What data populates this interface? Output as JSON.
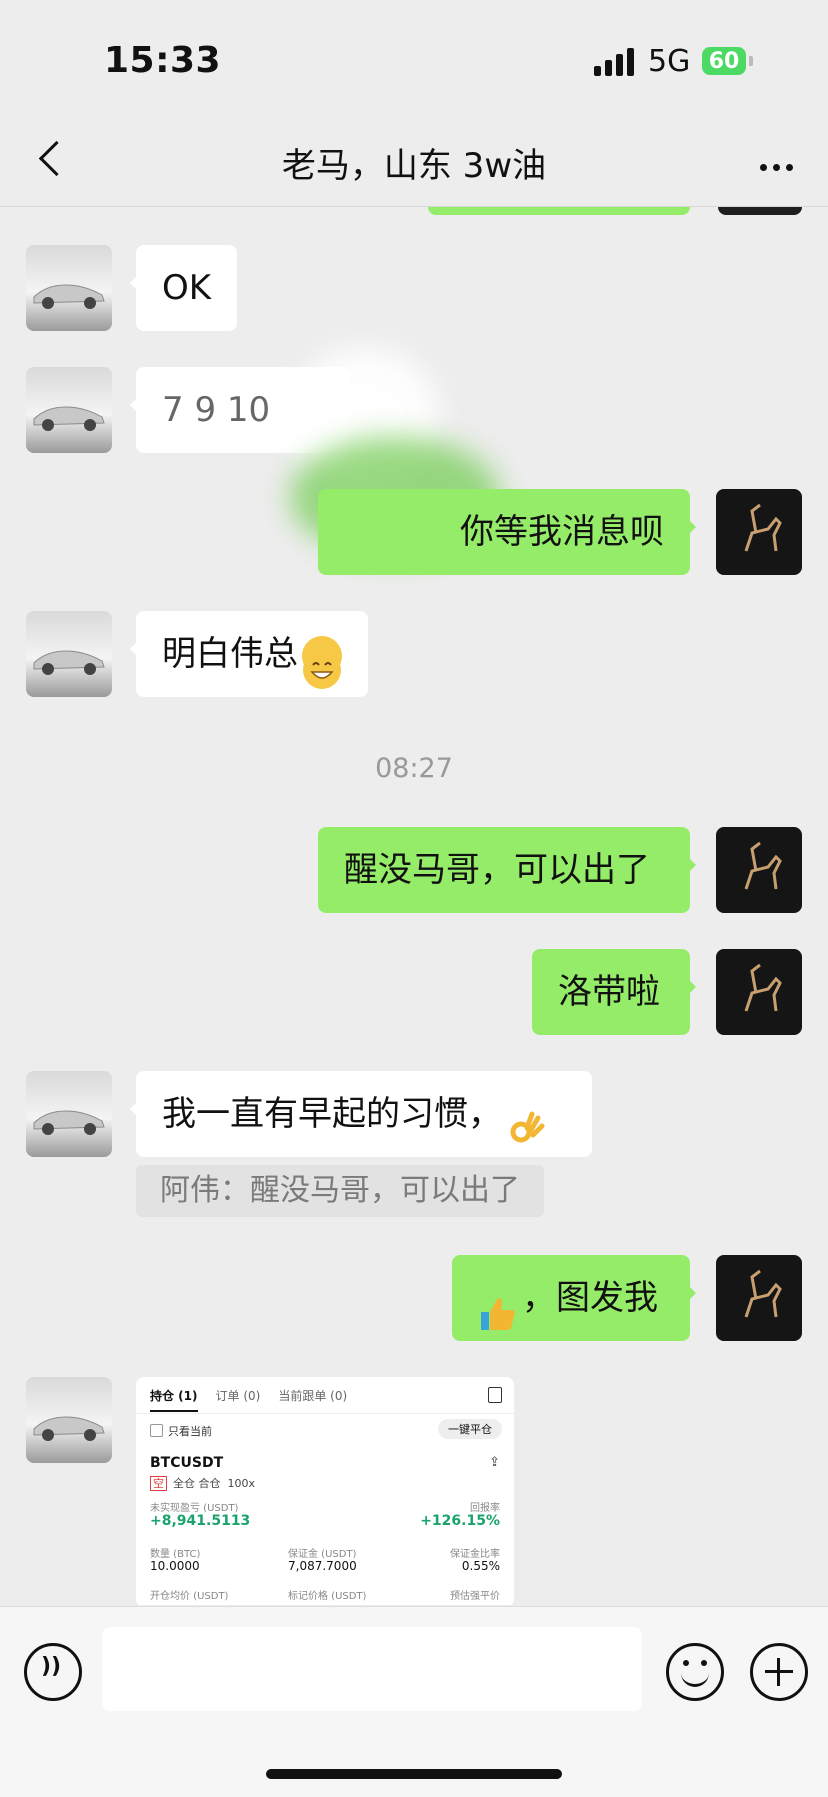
{
  "status_bar": {
    "time": "15:33",
    "network": "5G",
    "battery": "60"
  },
  "nav": {
    "title": "老马，山东 3w油"
  },
  "messages": {
    "m1": "OK",
    "m2": "7   9 10",
    "m3": "你等我消息呗",
    "m4": "明白伟总",
    "time_divider": "08:27",
    "m5": "醒没马哥，可以出了",
    "m6": "洛带啦",
    "m7": "我一直有早起的习惯，",
    "m7_quote": "阿伟：醒没马哥，可以出了",
    "m8": "，图发我"
  },
  "emojis": {
    "m4": "grinning-face-emoji",
    "m7": "ok-hand-emoji",
    "m8": "thumbs-up-emoji"
  },
  "card": {
    "tab_positions": "持仓 (1)",
    "tab_orders": "订单 (0)",
    "tab_copy": "当前跟单 (0)",
    "checkbox_label": "只看当前",
    "close_all": "一键平仓",
    "symbol": "BTCUSDT",
    "tag_short": "空",
    "tag_margin": "全仓 合仓",
    "tag_leverage": "100x",
    "pnl_label": "未实现盈亏 (USDT)",
    "pnl_value": "+8,941.5113",
    "roe_label": "回报率",
    "roe_value": "+126.15%",
    "qty_label": "数量 (BTC)",
    "qty_value": "10.0000",
    "margin_label": "保证金 (USDT)",
    "margin_value": "7,087.7000",
    "margin_ratio_label": "保证金比率",
    "margin_ratio_value": "0.55%",
    "entry_label": "开仓均价 (USDT)",
    "mark_label": "标记价格 (USDT)",
    "liq_label": "预估强平价"
  },
  "colors": {
    "bubble_out": "#95ec69",
    "bubble_in": "#ffffff",
    "background": "#ededed",
    "profit": "#1aa36b"
  }
}
